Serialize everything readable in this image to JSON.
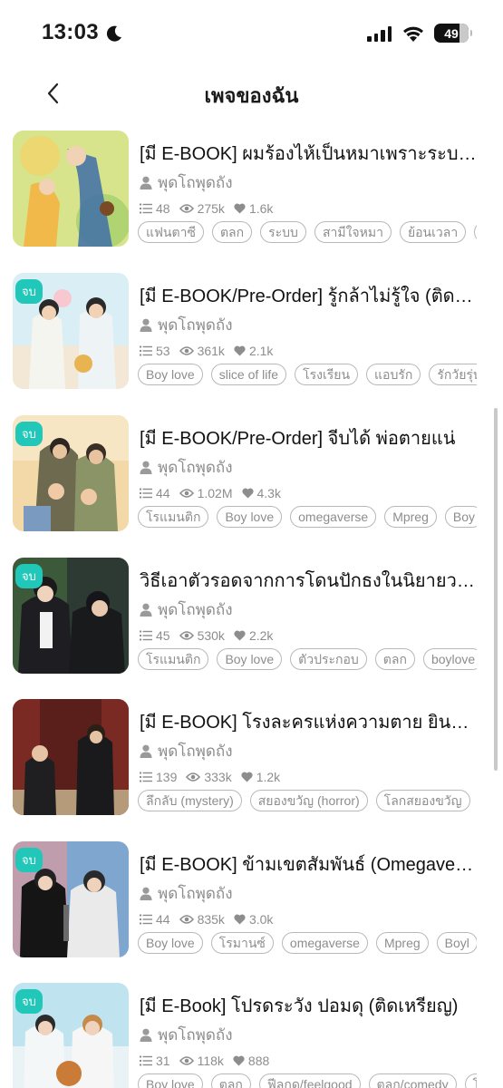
{
  "status": {
    "time": "13:03",
    "battery": "49"
  },
  "header": {
    "title": "เพจของฉัน"
  },
  "books": [
    {
      "title": "[มี E-BOOK] ผมร้องไห้เป็นหมาเพราะระบบรักเมียรัก",
      "author": "พุดโถพุดถัง",
      "chapters": "48",
      "views": "275k",
      "likes": "1.6k",
      "completed": false,
      "completed_label": "",
      "tags": [
        "แฟนตาซี",
        "ตลก",
        "ระบบ",
        "สามีใจหมา",
        "ย้อนเวลา",
        "S"
      ]
    },
    {
      "title": "[มี E-BOOK/Pre-Order] รู้กล้าไม่รู้ใจ (ติดเหรียญ)",
      "author": "พุดโถพุดถัง",
      "chapters": "53",
      "views": "361k",
      "likes": "2.1k",
      "completed": true,
      "completed_label": "จบ",
      "tags": [
        "Boy love",
        "slice of life",
        "โรงเรียน",
        "แอบรัก",
        "รักวัยรุ่น"
      ]
    },
    {
      "title": "[มี E-BOOK/Pre-Order] จีบได้ พ่อตายแน่",
      "author": "พุดโถพุดถัง",
      "chapters": "44",
      "views": "1.02M",
      "likes": "4.3k",
      "completed": true,
      "completed_label": "จบ",
      "tags": [
        "โรแมนติก",
        "Boy love",
        "omegaverse",
        "Mpreg",
        "Boy"
      ]
    },
    {
      "title": "วิธีเอาตัวรอดจากการโดนปักธงในนิยายวาย",
      "author": "พุดโถพุดถัง",
      "chapters": "45",
      "views": "530k",
      "likes": "2.2k",
      "completed": true,
      "completed_label": "จบ",
      "tags": [
        "โรแมนติก",
        "Boy love",
        "ตัวประกอบ",
        "ตลก",
        "boylove"
      ]
    },
    {
      "title": "[มี E-BOOK] โรงละครแห่งความตาย ยินดีต้อนรับ",
      "author": "พุดโถพุดถัง",
      "chapters": "139",
      "views": "333k",
      "likes": "1.2k",
      "completed": false,
      "completed_label": "",
      "tags": [
        "ลึกลับ (mystery)",
        "สยองขวัญ (horror)",
        "โลกสยองขวัญ"
      ]
    },
    {
      "title": "[มี E-BOOK] ข้ามเขตสัมพันธ์ (Omegaverse)",
      "author": "พุดโถพุดถัง",
      "chapters": "44",
      "views": "835k",
      "likes": "3.0k",
      "completed": true,
      "completed_label": "จบ",
      "tags": [
        "Boy love",
        "โรมานซ์",
        "omegaverse",
        "Mpreg",
        "Boyl"
      ]
    },
    {
      "title": "[มี E-Book] โปรดระวัง ปอมดุ (ติดเหรียญ)",
      "author": "พุดโถพุดถัง",
      "chapters": "31",
      "views": "118k",
      "likes": "888",
      "completed": true,
      "completed_label": "จบ",
      "tags": [
        "Boy love",
        "ตลก",
        "ฟีลกูด/feelgood",
        "ตลก/comedy",
        "โร"
      ]
    }
  ]
}
